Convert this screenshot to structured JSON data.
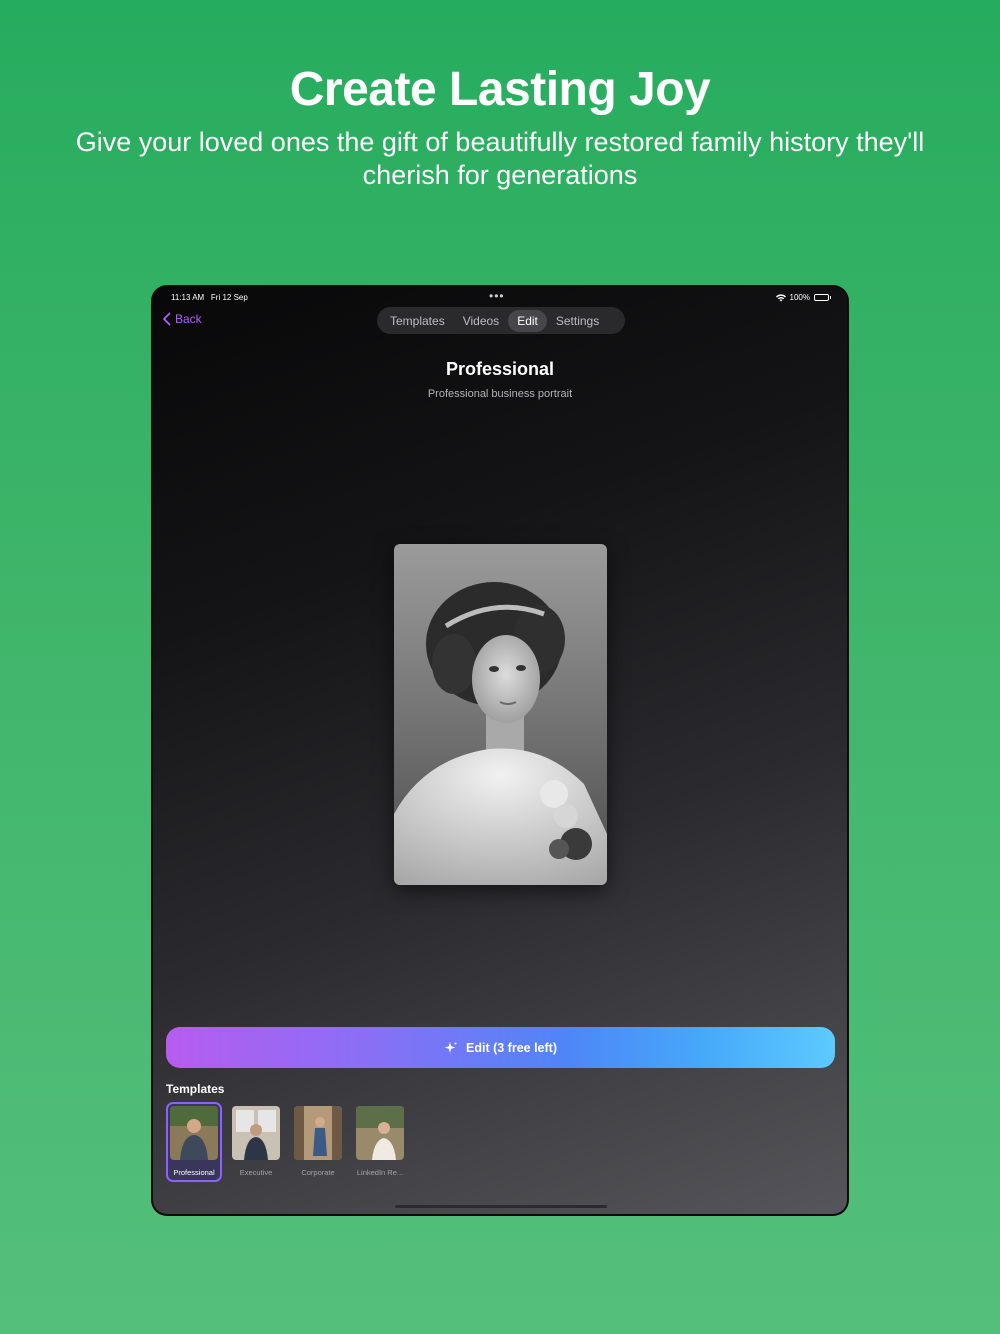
{
  "marketing": {
    "headline": "Create Lasting Joy",
    "subheadline": "Give your loved ones the gift of beautifully restored family history they'll cherish for generations"
  },
  "status_bar": {
    "time": "11:13 AM",
    "date": "Fri 12 Sep",
    "battery": "100%"
  },
  "nav": {
    "back_label": "Back",
    "tabs": [
      {
        "label": "Templates",
        "active": false
      },
      {
        "label": "Videos",
        "active": false
      },
      {
        "label": "Edit",
        "active": true
      },
      {
        "label": "Settings",
        "active": false
      }
    ]
  },
  "template_header": {
    "title": "Professional",
    "description": "Professional business portrait"
  },
  "photo": {
    "description_icon": "vintage-portrait-image"
  },
  "action": {
    "edit_label": "Edit (3 free left)",
    "icon": "sparkle-icon"
  },
  "templates": {
    "label": "Templates",
    "items": [
      {
        "name": "Professional",
        "selected": true
      },
      {
        "name": "Executive",
        "selected": false
      },
      {
        "name": "Corporate",
        "selected": false
      },
      {
        "name": "LinkedIn Re...",
        "selected": false
      }
    ]
  },
  "colors": {
    "background_green": "#3fb56a",
    "accent_purple": "#b15cff",
    "button_gradient_start": "#b65cf0",
    "button_gradient_end": "#5ccaff"
  }
}
